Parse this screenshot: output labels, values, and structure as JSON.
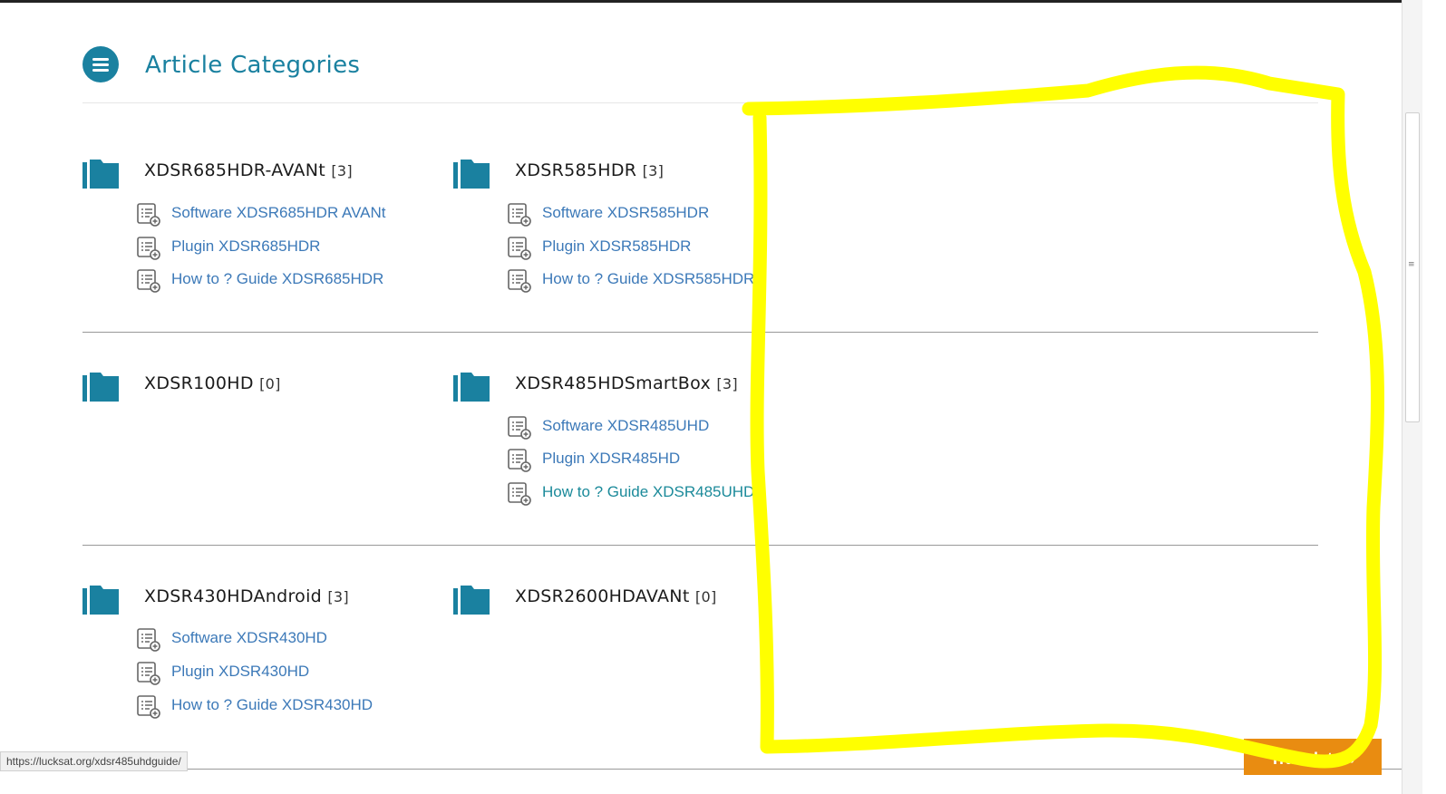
{
  "header": {
    "title": "Article Categories",
    "icon": "menu-icon",
    "accent": "#1a81a0"
  },
  "categories": [
    {
      "name": "XDSR685HDR-AVANt",
      "count": "[3]",
      "articles": [
        "Software XDSR685HDR AVANt",
        "Plugin XDSR685HDR",
        "How to ? Guide XDSR685HDR"
      ]
    },
    {
      "name": "XDSR585HDR",
      "count": "[3]",
      "articles": [
        "Software XDSR585HDR",
        "Plugin XDSR585HDR",
        "How to ? Guide XDSR585HDR"
      ]
    },
    {
      "name": "XDSR100HD",
      "count": "[0]",
      "articles": []
    },
    {
      "name": "XDSR485HDSmartBox",
      "count": "[3]",
      "articles": [
        "Software XDSR485UHD",
        "Plugin XDSR485HD",
        "How to ? Guide XDSR485UHD"
      ]
    },
    {
      "name": "XDSR430HDAndroid",
      "count": "[3]",
      "articles": [
        "Software XDSR430HD",
        "Plugin XDSR430HD",
        "How to ? Guide XDSR430HD"
      ]
    },
    {
      "name": "XDSR2600HDAVANt",
      "count": "[0]",
      "articles": []
    }
  ],
  "icons": {
    "folder": "folder-icon",
    "article": "article-list-icon",
    "highlight": "yellow-marker-outline"
  },
  "colors": {
    "link": "#3c79b8",
    "link_hover": "#1b8a9a",
    "highlight": "#ffff00",
    "translate_bg": "#e98c11"
  },
  "status_url": "https://lucksat.org/xdsr485uhdguide/",
  "translate_label": "Translate »"
}
